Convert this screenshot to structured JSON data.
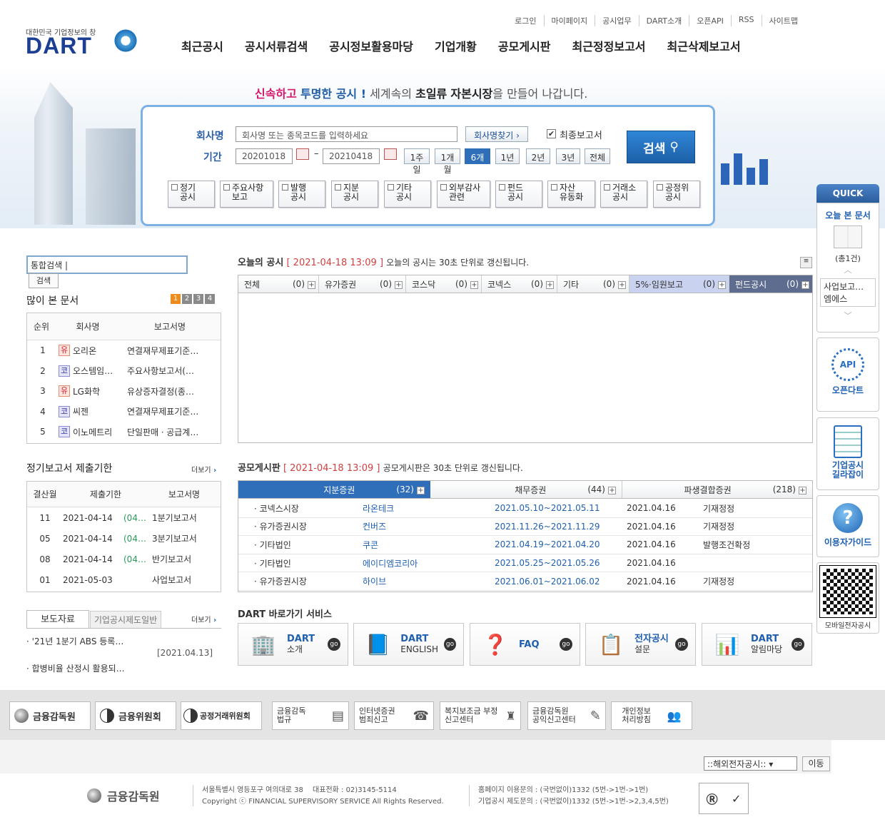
{
  "header": {
    "logo_small": "대한민국 기업정보의 창",
    "logo_text": "DART",
    "top_links": [
      "로그인",
      "마이페이지",
      "공시업무",
      "DART소개",
      "오픈API",
      "RSS",
      "사이트맵"
    ],
    "nav": [
      "최근공시",
      "공시서류검색",
      "공시정보활용마당",
      "기업개황",
      "공모게시판",
      "최근정정보고서",
      "최근삭제보고서"
    ]
  },
  "slogan": {
    "p1": "신속하고",
    "p2": "투명한 공시 !",
    "p3": "세계속의",
    "p4": "초일류",
    "p5": "자본시장",
    "p6": "을 만들어 나갑니다."
  },
  "search": {
    "company_label": "회사명",
    "company_placeholder": "회사명 또는 종목코드를 입력하세요",
    "find_company": "회사명찾기 ›",
    "final_report": "최종보고서",
    "period_label": "기간",
    "start_date": "20201018",
    "end_date": "20210418",
    "dash": "~",
    "periods": [
      "1주일",
      "1개월",
      "6개월",
      "1년",
      "2년",
      "3년",
      "전체"
    ],
    "search_btn": "검색",
    "categories": [
      [
        "정기",
        "공시"
      ],
      [
        "주요사항",
        "보고"
      ],
      [
        "발행",
        "공시"
      ],
      [
        "지분",
        "공시"
      ],
      [
        "기타",
        "공시"
      ],
      [
        "외부감사",
        "관련"
      ],
      [
        "펀드",
        "공시"
      ],
      [
        "자산",
        "유동화"
      ],
      [
        "거래소",
        "공시"
      ],
      [
        "공정위",
        "공시"
      ]
    ]
  },
  "left": {
    "isearch_label": "통합검색",
    "isearch_btn": "검색",
    "popular_title": "많이 본 문서",
    "popular_pages": [
      "1",
      "2",
      "3",
      "4"
    ],
    "popular_headers": [
      "순위",
      "회사명",
      "보고서명"
    ],
    "popular": [
      {
        "rank": "1",
        "badge": "유",
        "company": "오리온",
        "report": "연결재무제표기준…"
      },
      {
        "rank": "2",
        "badge": "코",
        "company": "오스템임…",
        "report": "주요사항보고서(…"
      },
      {
        "rank": "3",
        "badge": "유",
        "company": "LG화학",
        "report": "유상증자결정(종…"
      },
      {
        "rank": "4",
        "badge": "코",
        "company": "씨젠",
        "report": "연결재무제표기준…"
      },
      {
        "rank": "5",
        "badge": "코",
        "company": "이노메트리",
        "report": "단일판매ㆍ공급계…"
      }
    ],
    "deadline_title": "정기보고서 제출기한",
    "more": "더보기",
    "deadline_headers": [
      "결산월",
      "제출기한",
      "보고서명"
    ],
    "deadlines": [
      {
        "month": "11",
        "date": "2021-04-14",
        "ext": "(04…",
        "report": "1분기보고서"
      },
      {
        "month": "05",
        "date": "2021-04-14",
        "ext": "(04…",
        "report": "3분기보고서"
      },
      {
        "month": "08",
        "date": "2021-04-14",
        "ext": "(04…",
        "report": "반기보고서"
      },
      {
        "month": "01",
        "date": "2021-05-03",
        "ext": "",
        "report": "사업보고서"
      }
    ],
    "press_tabs": [
      "보도자료",
      "기업공시제도일반"
    ],
    "press": [
      {
        "title": "'21년 1분기 ABS 등록…",
        "date": "[2021.04.13]"
      },
      {
        "title": "합병비율 산정시 활용되…",
        "date": ""
      }
    ]
  },
  "today": {
    "title": "오늘의 공시",
    "time": "[ 2021-04-18 13:09 ]",
    "note": "오늘의 공시는 30초 단위로 갱신됩니다.",
    "tabs": [
      {
        "label": "전체",
        "count": "(0)"
      },
      {
        "label": "유가증권",
        "count": "(0)"
      },
      {
        "label": "코스닥",
        "count": "(0)"
      },
      {
        "label": "코넥스",
        "count": "(0)"
      },
      {
        "label": "기타",
        "count": "(0)"
      },
      {
        "label": "5%·임원보고",
        "count": "(0)"
      },
      {
        "label": "펀드공시",
        "count": "(0)"
      }
    ]
  },
  "offer": {
    "title": "공모게시판",
    "time": "[ 2021-04-18 13:09 ]",
    "note": "공모게시판은 30초 단위로 갱신됩니다.",
    "tabs": [
      {
        "label": "지분증권",
        "count": "(32)"
      },
      {
        "label": "채무증권",
        "count": "(44)"
      },
      {
        "label": "파생결합증권",
        "count": "(218)"
      }
    ],
    "rows": [
      {
        "market": "코넥스시장",
        "company": "라온테크",
        "period": "2021.05.10~2021.05.11",
        "date": "2021.04.16",
        "status": "기재정정"
      },
      {
        "market": "유가증권시장",
        "company": "컨버즈",
        "period": "2021.11.26~2021.11.29",
        "date": "2021.04.16",
        "status": "기재정정"
      },
      {
        "market": "기타법인",
        "company": "쿠콘",
        "period": "2021.04.19~2021.04.20",
        "date": "2021.04.16",
        "status": "발행조건확정"
      },
      {
        "market": "기타법인",
        "company": "에이디엠코리아",
        "period": "2021.05.25~2021.05.26",
        "date": "2021.04.16",
        "status": ""
      },
      {
        "market": "유가증권시장",
        "company": "하이브",
        "period": "2021.06.01~2021.06.02",
        "date": "2021.04.16",
        "status": "기재정정"
      }
    ]
  },
  "shortcuts": {
    "title": "DART 바로가기 서비스",
    "items": [
      [
        "DART",
        "소개"
      ],
      [
        "DART",
        "ENGLISH"
      ],
      [
        "FAQ",
        ""
      ],
      [
        "전자공시",
        "설문"
      ],
      [
        "DART",
        "알림마당"
      ]
    ],
    "go": "go"
  },
  "quick": {
    "title": "QUICK",
    "today_viewed": "오늘 본 문서",
    "count": "(총1건)",
    "item": "사업보고…",
    "item_sub": "엠에스",
    "api_label": "API",
    "open_dart": "오픈다트",
    "guide1": "기업공시",
    "guide2": "길라잡이",
    "user_guide": "이용자가이드",
    "mobile": "모바일전자공시"
  },
  "footer": {
    "banners": [
      "금융감독원",
      "금융위원회",
      "공정거래위원회",
      [
        "금융감독",
        "법규"
      ],
      [
        "인터넷증권",
        "범죄신고"
      ],
      [
        "복지보조금 부정",
        "신고센터"
      ],
      [
        "금융감독원",
        "공익신고센터"
      ],
      [
        "개인정보",
        "처리방침"
      ]
    ],
    "overseas": "::해외전자공시::",
    "move": "이동",
    "org": "금융감독원",
    "address": "서울특별시 영등포구 여의대로 38　 대표전화 : 02)3145-5114",
    "copyright": "Copyright ⓒ FINANCIAL SUPERVISORY SERVICE All Rights Reserved.",
    "contact1": "홈페이지 이용문의 : (국번없이)1332 (5번->1번->1번)",
    "contact2": "기업공시 제도문의 : (국번없이)1332 (5번->1번->2,3,4,5번)"
  }
}
